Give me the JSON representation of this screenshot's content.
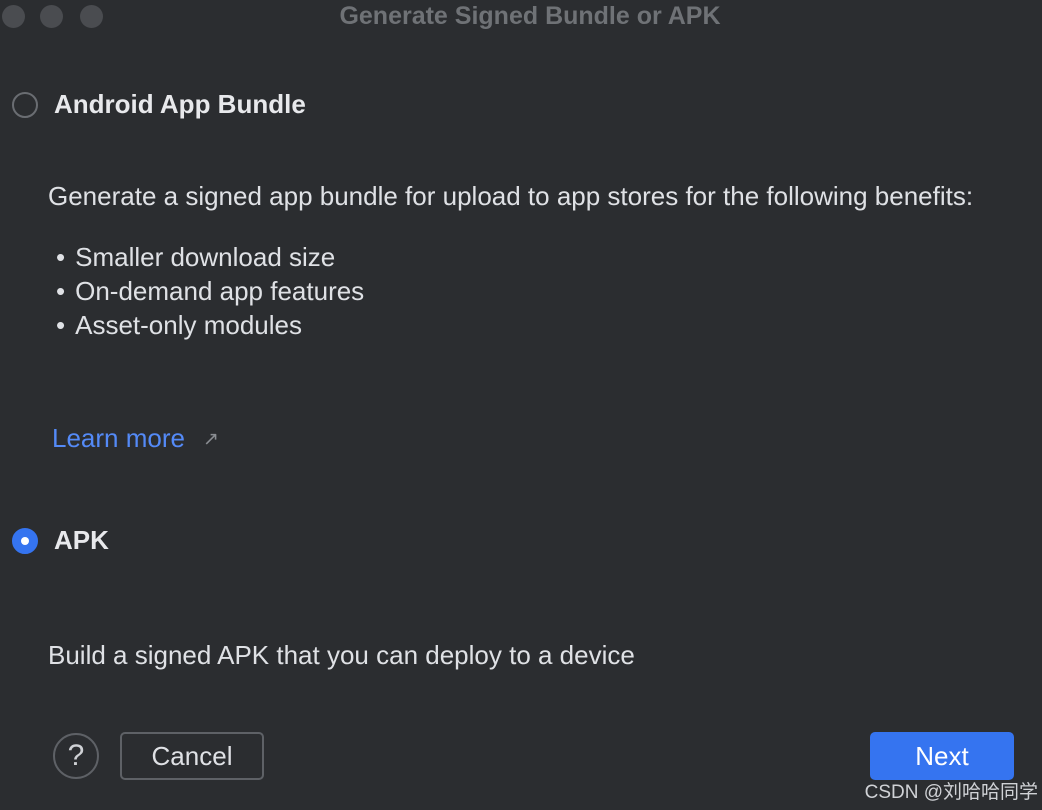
{
  "window": {
    "title": "Generate Signed Bundle or APK"
  },
  "options": {
    "bundle": {
      "label": "Android App Bundle",
      "selected": false,
      "description": "Generate a signed app bundle for upload to app stores for the following benefits:",
      "benefits": [
        "Smaller download size",
        "On-demand app features",
        "Asset-only modules"
      ],
      "learn_more": "Learn more",
      "learn_more_icon": "external-link-icon"
    },
    "apk": {
      "label": "APK",
      "selected": true,
      "description": "Build a signed APK that you can deploy to a device"
    }
  },
  "footer": {
    "help_label": "?",
    "cancel_label": "Cancel",
    "next_label": "Next"
  },
  "watermark": "CSDN @刘哈哈同学",
  "colors": {
    "background": "#2b2d30",
    "accent": "#3574f0",
    "link": "#548af7"
  }
}
